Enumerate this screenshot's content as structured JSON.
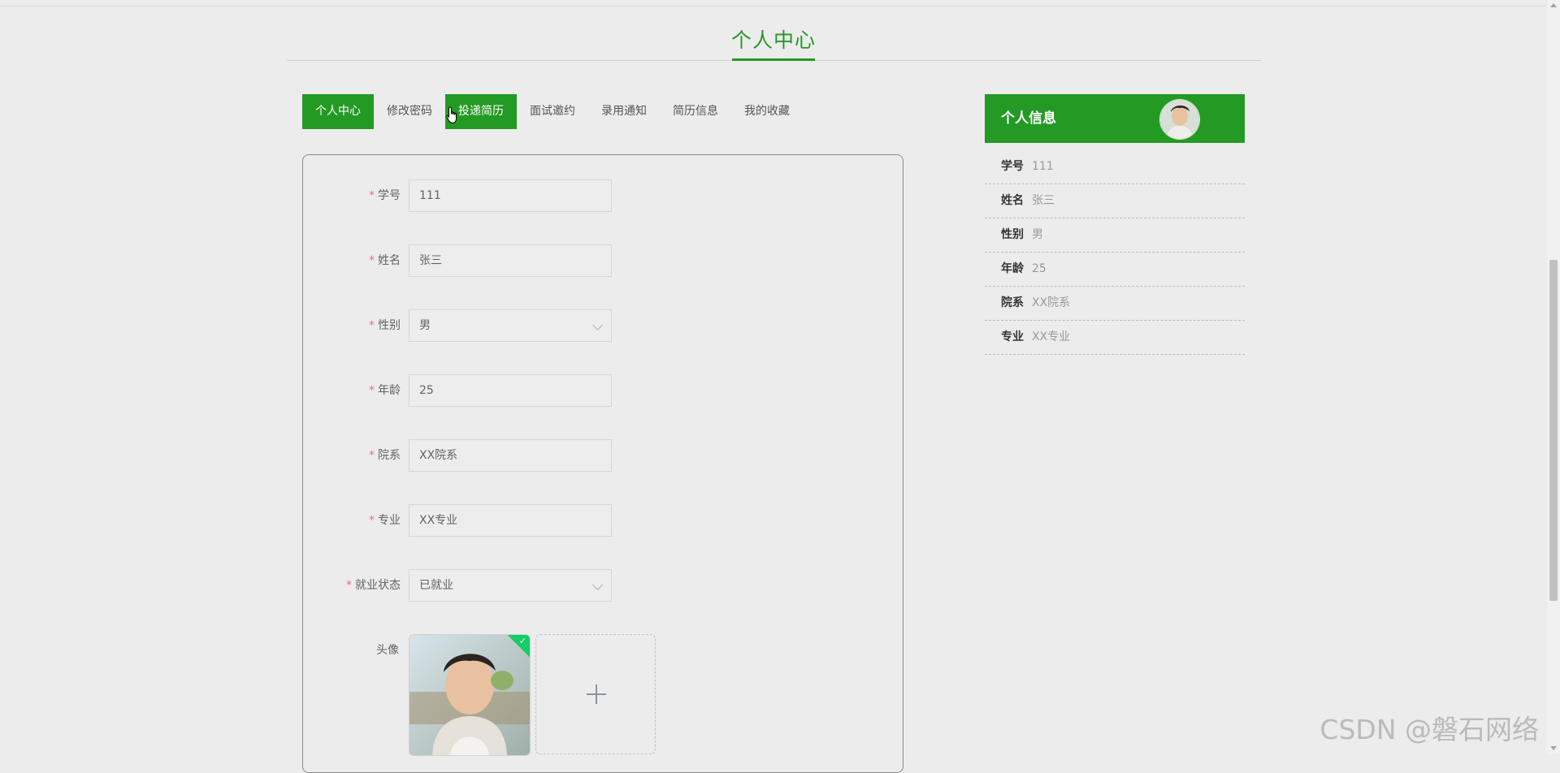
{
  "page": {
    "title": "个人中心"
  },
  "tabs": [
    {
      "label": "个人中心",
      "state": "active"
    },
    {
      "label": "修改密码",
      "state": "normal"
    },
    {
      "label": "投递简历",
      "state": "hover"
    },
    {
      "label": "面试邀约",
      "state": "normal"
    },
    {
      "label": "录用通知",
      "state": "normal"
    },
    {
      "label": "简历信息",
      "state": "normal"
    },
    {
      "label": "我的收藏",
      "state": "normal"
    }
  ],
  "form": {
    "student_id": {
      "label": "学号",
      "value": "111",
      "required": true
    },
    "name": {
      "label": "姓名",
      "value": "张三",
      "required": true
    },
    "gender": {
      "label": "性别",
      "value": "男",
      "required": true
    },
    "age": {
      "label": "年龄",
      "value": "25",
      "required": true
    },
    "department": {
      "label": "院系",
      "value": "XX院系",
      "required": true
    },
    "major": {
      "label": "专业",
      "value": "XX专业",
      "required": true
    },
    "employment_status": {
      "label": "就业状态",
      "value": "已就业",
      "required": true
    },
    "avatar": {
      "label": "头像",
      "required": false
    },
    "required_mark": "*",
    "upload_plus": "+",
    "success_check": "✓"
  },
  "side_panel": {
    "title": "个人信息",
    "items": [
      {
        "key": "学号",
        "value": "111"
      },
      {
        "key": "姓名",
        "value": "张三"
      },
      {
        "key": "性别",
        "value": "男"
      },
      {
        "key": "年龄",
        "value": "25"
      },
      {
        "key": "院系",
        "value": "XX院系"
      },
      {
        "key": "专业",
        "value": "XX专业"
      }
    ]
  },
  "watermark": "CSDN @磐石网络",
  "colors": {
    "accent": "#239a23",
    "required": "#f56c6c",
    "success": "#13ce66",
    "background": "#ececec"
  },
  "icons": {
    "cursor": "pointer-hand-icon",
    "select_arrow": "chevron-down-icon",
    "upload": "plus-icon",
    "success": "check-icon"
  }
}
